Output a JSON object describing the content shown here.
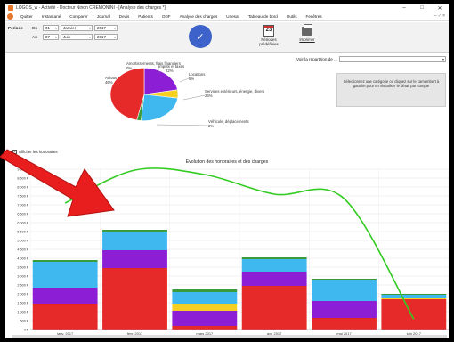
{
  "window": {
    "title": "LOGOS_w - Activité - Docteur Ninon CREMONINI - [Analyse des charges *]",
    "controls": [
      "–",
      "□",
      "✕"
    ]
  },
  "menu": {
    "items": [
      "Quitter",
      "Instantané",
      "Comparer",
      "Journal",
      "Devis",
      "Patients",
      "ODF",
      "Analyse des charges",
      "Unesaf",
      "Tableau de bord",
      "Outils",
      "Fenêtres"
    ],
    "right_controls": "– ♂ ×"
  },
  "toolbar": {
    "period_label": "Période",
    "from_label": "Du",
    "to_label": "Au",
    "from_day": "01",
    "from_month": "Janvier",
    "from_year": "2017",
    "to_day": "07",
    "to_month": "Juin",
    "to_year": "2017",
    "ok_symbol": "✓",
    "calendar_day": "23",
    "predefined_label": "Périodes prédéfinies",
    "print_label": "Imprimer"
  },
  "pie_panel": {
    "side_label": "Voir la répartition de ...",
    "side_value": "",
    "info_text": "Sélectionnez une catégorie ou cliquez sur le camembert à gauche pour en visualiser le détail par compte"
  },
  "pie_data": {
    "type": "pie",
    "slices": [
      {
        "label": "Achats",
        "percent": 46,
        "color": "#e62a2a"
      },
      {
        "label": "Amortissements, frais financiers",
        "percent": 0,
        "color": "#ffffff"
      },
      {
        "label": "Impôts et taxes",
        "percent": 22,
        "color": "#8c1fd6"
      },
      {
        "label": "Locations",
        "percent": 5,
        "color": "#f5d023"
      },
      {
        "label": "Services extérieurs, énergie, divers",
        "percent": 24,
        "color": "#3fb8f0"
      },
      {
        "label": "Véhicule, déplacements",
        "percent": 2,
        "color": "#3a9b3a"
      }
    ],
    "labels": [
      {
        "name": "Amortissements, frais financiers",
        "pct": "0%"
      },
      {
        "name": "Impôts et taxes",
        "pct": "22%"
      },
      {
        "name": "Locations",
        "pct": "5%"
      },
      {
        "name": "Achats",
        "pct": "46%"
      },
      {
        "name": "Services extérieurs, énergie, divers",
        "pct": "24%"
      },
      {
        "name": "Véhicule, déplacements",
        "pct": "2%"
      }
    ]
  },
  "checkbox": {
    "label": "Afficher les honoraires",
    "checked": true
  },
  "chart_data": {
    "type": "bar",
    "title": "Evolution des honoraires et des charges",
    "categories": [
      "janv. 2017",
      "févr. 2017",
      "mars 2017",
      "avr. 2017",
      "mai 2017",
      "juin 2017"
    ],
    "yticks": [
      "0 €",
      "500 €",
      "1 000 €",
      "1 500 €",
      "2 000 €",
      "2 500 €",
      "3 000 €",
      "3 500 €",
      "4 000 €",
      "4 500 €",
      "5 000 €",
      "5 500 €",
      "6 000 €",
      "6 500 €",
      "7 000 €",
      "7 500 €",
      "8 000 €",
      "8 500 €",
      "9 000 €"
    ],
    "ylim": [
      0,
      9000
    ],
    "stacked": true,
    "series": [
      {
        "name": "Achats",
        "color": "#e62a2a",
        "values": [
          1450,
          3450,
          200,
          2450,
          650,
          1700
        ]
      },
      {
        "name": "Impôts et taxes",
        "color": "#8c1fd6",
        "values": [
          900,
          1000,
          850,
          800,
          950,
          0
        ]
      },
      {
        "name": "Locations",
        "color": "#f5d023",
        "values": [
          0,
          0,
          400,
          0,
          0,
          50
        ]
      },
      {
        "name": "Services extérieurs, énergie, divers",
        "color": "#3fb8f0",
        "values": [
          1450,
          1050,
          650,
          700,
          1200,
          200
        ]
      },
      {
        "name": "Véhicule, déplacements",
        "color": "#3a9b3a",
        "values": [
          100,
          100,
          150,
          100,
          50,
          50
        ]
      }
    ],
    "line": {
      "name": "Honoraires",
      "color": "#33cc22",
      "values": [
        7100,
        8950,
        8700,
        7600,
        7350,
        580
      ]
    }
  }
}
